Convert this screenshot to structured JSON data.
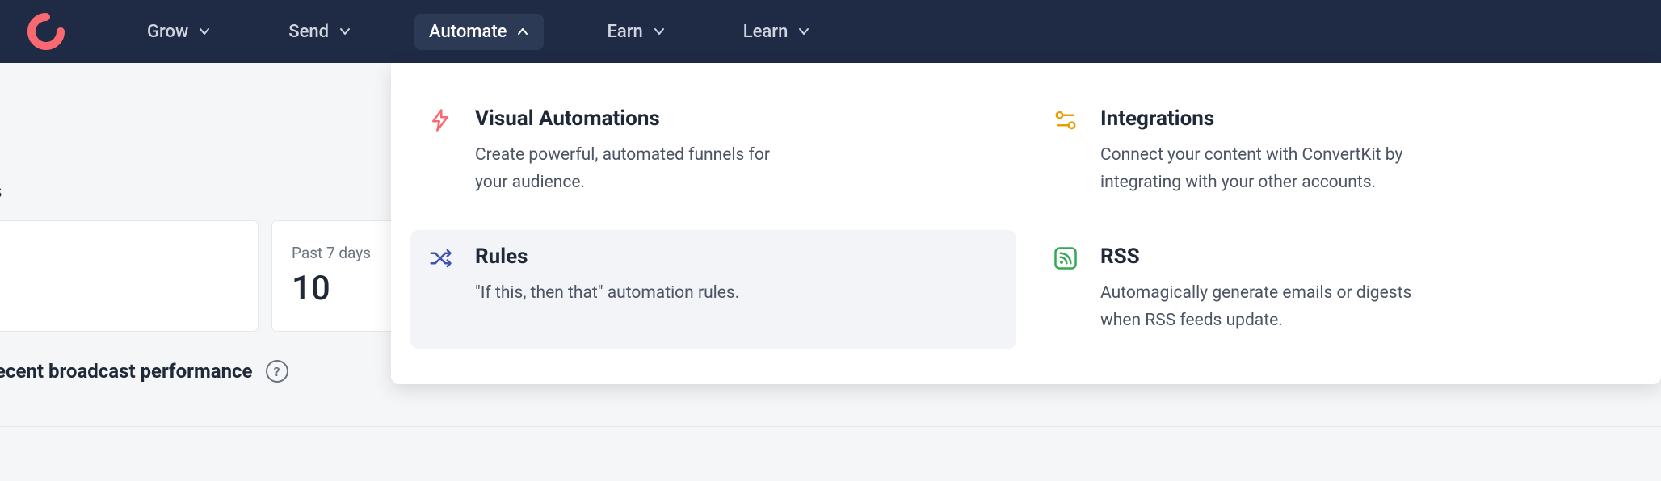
{
  "nav": {
    "items": [
      {
        "label": "Grow"
      },
      {
        "label": "Send"
      },
      {
        "label": "Automate"
      },
      {
        "label": "Earn"
      },
      {
        "label": "Learn"
      }
    ]
  },
  "dropdown": {
    "visual_automations": {
      "title": "Visual Automations",
      "desc": "Create powerful, automated funnels for your audience."
    },
    "integrations": {
      "title": "Integrations",
      "desc": "Connect your content with ConvertKit by integrating with your other accounts."
    },
    "rules": {
      "title": "Rules",
      "desc": "\"If this, then that\" automation rules."
    },
    "rss": {
      "title": "RSS",
      "desc": "Automagically generate emails or digests when RSS feeds update."
    }
  },
  "stats": {
    "section_fragment": "s",
    "past7_label": "Past 7 days",
    "past7_value": "10"
  },
  "broadcast": {
    "title": "ecent broadcast performance",
    "help": "?"
  },
  "colors": {
    "nav_bg": "#1f2a44",
    "accent": "#fb6970",
    "rules_icon": "#3f51b5",
    "integrations_icon": "#e6a100",
    "rss_icon": "#34a853"
  }
}
